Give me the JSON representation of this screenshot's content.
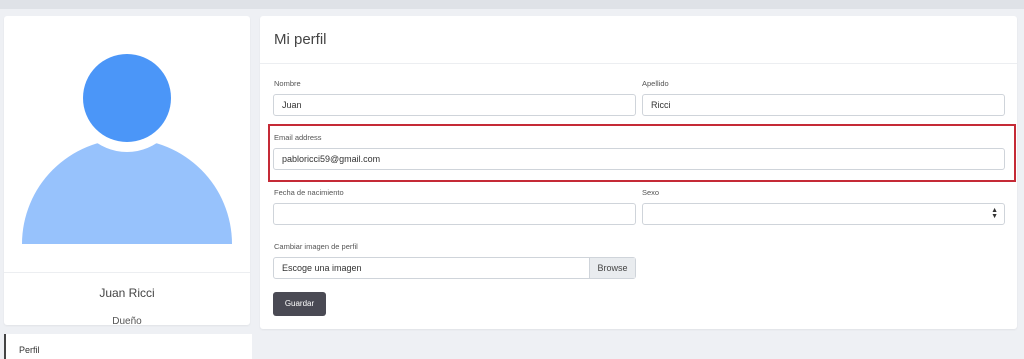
{
  "profile": {
    "name": "Juan Ricci",
    "role": "Dueño"
  },
  "nav": {
    "items": [
      {
        "label": "Perfil"
      }
    ]
  },
  "form": {
    "title": "Mi perfil",
    "nombre": {
      "label": "Nombre",
      "value": "Juan"
    },
    "apellido": {
      "label": "Apellido",
      "value": "Ricci"
    },
    "email": {
      "label": "Email address",
      "value": "pabloricci59@gmail.com"
    },
    "fecha": {
      "label": "Fecha de nacimiento",
      "value": ""
    },
    "sexo": {
      "label": "Sexo",
      "value": ""
    },
    "imagen": {
      "label": "Cambiar imagen de perfil",
      "placeholder": "Escoge una imagen",
      "browse": "Browse"
    },
    "save_label": "Guardar"
  },
  "colors": {
    "avatar_head": "#4b96f8",
    "avatar_body": "#97c2fc",
    "highlight": "#c52a36",
    "save_button": "#4a4a54"
  },
  "icons": {
    "select_arrow": "sort-arrows-icon"
  }
}
